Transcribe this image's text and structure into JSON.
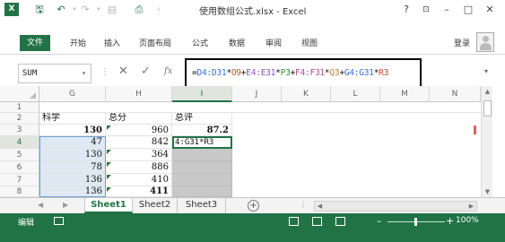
{
  "titlebar": {
    "app_logo": "X",
    "save_icon": "save-icon",
    "undo_icon": "undo-icon",
    "redo_icon": "redo-icon",
    "title": "使用数组公式.xlsx - Excel",
    "help": "?",
    "minimize": "–",
    "maximize": "□",
    "close": "✕"
  },
  "ribbon": {
    "tabs": [
      "文件",
      "开始",
      "插入",
      "页面布局",
      "公式",
      "数据",
      "审阅",
      "视图"
    ],
    "login": "登录"
  },
  "formula_bar": {
    "name_box": "SUM",
    "fx": "fx",
    "formula_parts": [
      {
        "text": "=",
        "color": "#111111"
      },
      {
        "text": "D4:D31",
        "color": "#3a6fd1"
      },
      {
        "text": "*",
        "color": "#111111"
      },
      {
        "text": "O9",
        "color": "#d14b2b"
      },
      {
        "text": "+",
        "color": "#111111"
      },
      {
        "text": "E4:E31",
        "color": "#8a56c2"
      },
      {
        "text": "*",
        "color": "#111111"
      },
      {
        "text": "P3",
        "color": "#2f8f3a"
      },
      {
        "text": "+",
        "color": "#111111"
      },
      {
        "text": "F4:F31",
        "color": "#b04aa0"
      },
      {
        "text": "*",
        "color": "#111111"
      },
      {
        "text": "Q3",
        "color": "#c9822c"
      },
      {
        "text": "+",
        "color": "#111111"
      },
      {
        "text": "G4:G31",
        "color": "#3a6fd1"
      },
      {
        "text": "*",
        "color": "#111111"
      },
      {
        "text": "R3",
        "color": "#d14b2b"
      }
    ]
  },
  "grid": {
    "columns": [
      "G",
      "H",
      "I",
      "J",
      "K",
      "L",
      "M",
      "N"
    ],
    "active_column": "I",
    "rows": [
      "1",
      "2",
      "3",
      "4",
      "5",
      "6",
      "7",
      "8"
    ],
    "active_row": "4",
    "row2": {
      "g": "科学",
      "h": "总分",
      "i": "总评"
    },
    "g_values": [
      "130",
      "47",
      "130",
      "78",
      "136",
      "136"
    ],
    "h_values": [
      "960",
      "842",
      "364",
      "886",
      "410",
      "411"
    ],
    "i3": "87.2",
    "i4_edit": "4:G31*R3"
  },
  "sheets": {
    "tabs": [
      "Sheet1",
      "Sheet2",
      "Sheet3"
    ],
    "active": "Sheet1",
    "add": "+"
  },
  "status": {
    "mode": "编辑",
    "zoom": "100%"
  },
  "colors": {
    "accent": "#217346",
    "selection": "#dfe9f3",
    "array_fill": "#c8c8c8"
  }
}
